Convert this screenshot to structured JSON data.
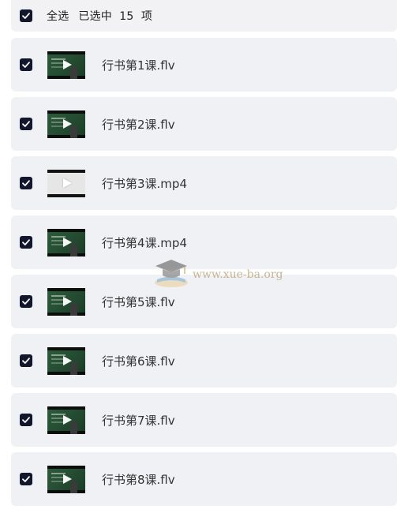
{
  "header": {
    "select_all_label": "全选",
    "selected_summary": "已选中  15  项"
  },
  "files": [
    {
      "name": "行书第1课.flv",
      "checked": true,
      "thumb": "video-thumbnail"
    },
    {
      "name": "行书第2课.flv",
      "checked": true,
      "thumb": "video-thumbnail"
    },
    {
      "name": "行书第3课.mp4",
      "checked": true,
      "thumb": "blank-video-thumbnail"
    },
    {
      "name": "行书第4课.mp4",
      "checked": true,
      "thumb": "video-thumbnail"
    },
    {
      "name": "行书第5课.flv",
      "checked": true,
      "thumb": "video-thumbnail"
    },
    {
      "name": "行书第6课.flv",
      "checked": true,
      "thumb": "video-thumbnail"
    },
    {
      "name": "行书第7课.flv",
      "checked": true,
      "thumb": "video-thumbnail"
    },
    {
      "name": "行书第8课.flv",
      "checked": true,
      "thumb": "video-thumbnail"
    }
  ],
  "watermark": {
    "text": "www.xue-ba.org",
    "icon": "graduation-cap-icon"
  },
  "colors": {
    "checkbox": "#12172e",
    "row_background": "#f0f1f4",
    "text": "#333333",
    "watermark": "#b69d73"
  }
}
